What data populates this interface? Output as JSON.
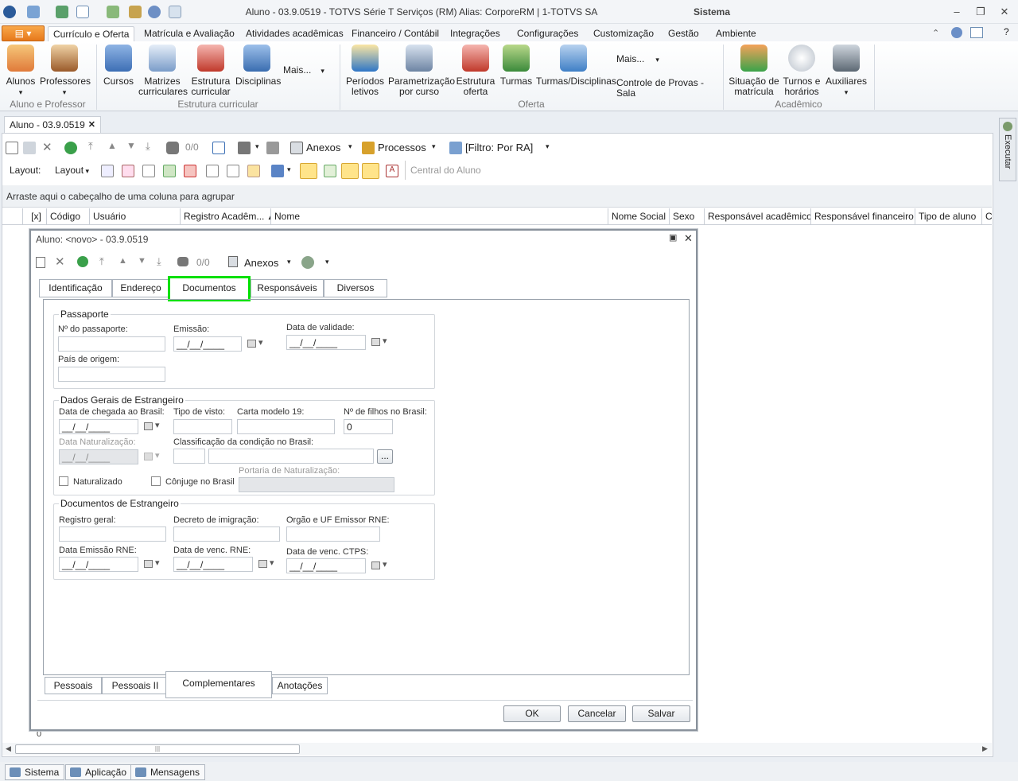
{
  "window": {
    "title": "Aluno - 03.9.0519 - TOTVS Série T Serviços (RM) Alias: CorporeRM | 1-TOTVS SA",
    "system_label": "Sistema"
  },
  "ribbon": {
    "tabs": [
      "Currículo e Oferta",
      "Matrícula e Avaliação",
      "Atividades acadêmicas",
      "Financeiro / Contábil",
      "Integrações",
      "Configurações",
      "Customização",
      "Gestão",
      "Ambiente"
    ],
    "active_tab": "Currículo e Oferta",
    "groups": [
      {
        "label": "Aluno e Professor",
        "buttons": [
          "Alunos",
          "Professores"
        ]
      },
      {
        "label": "Estrutura curricular",
        "buttons": [
          "Cursos",
          "Matrizes curriculares",
          "Estrutura curricular",
          "Disciplinas",
          "Mais..."
        ]
      },
      {
        "label": "Oferta",
        "buttons": [
          "Períodos letivos",
          "Parametrização por curso",
          "Estrutura oferta",
          "Turmas",
          "Turmas/Disciplinas",
          "Mais...",
          "Controle de Provas - Sala"
        ]
      },
      {
        "label": "Acadêmico",
        "buttons": [
          "Situação de matrícula",
          "Turnos e horários",
          "Auxiliares"
        ]
      }
    ]
  },
  "doc_tab": {
    "label": "Aluno - 03.9.0519"
  },
  "toolbar": {
    "counter": "0/0",
    "anexos": "Anexos",
    "processos": "Processos",
    "filtro": "[Filtro: Por RA]",
    "layout_label": "Layout:",
    "layout_btn": "Layout",
    "central": "Central do Aluno"
  },
  "grid": {
    "group_hint": "Arraste aqui o cabeçalho de uma coluna para agrupar",
    "columns": [
      "[x]",
      "Código",
      "Usuário",
      "Registro Acadêm...",
      "Nome",
      "Nome Social",
      "Sexo",
      "Responsável acadêmico",
      "Responsável financeiro",
      "Tipo de aluno",
      "C"
    ],
    "row_count": "0"
  },
  "side_panel": {
    "label": "Executar"
  },
  "statusbar": {
    "buttons": [
      "Sistema",
      "Aplicação",
      "Mensagens"
    ]
  },
  "modal": {
    "title": "Aluno: <novo> - 03.9.0519",
    "toolbar": {
      "counter": "0/0",
      "anexos": "Anexos"
    },
    "tabs": [
      "Identificação",
      "Endereço",
      "Documentos",
      "Responsáveis",
      "Diversos"
    ],
    "active_tab": "Documentos",
    "bottom_tabs": [
      "Pessoais",
      "Pessoais II",
      "Complementares",
      "Anotações"
    ],
    "active_bottom_tab": "Complementares",
    "passaporte": {
      "legend": "Passaporte",
      "numero_label": "Nº do passaporte:",
      "emissao_label": "Emissão:",
      "emissao_value": "__/__/____",
      "validade_label": "Data de validade:",
      "validade_value": "__/__/____",
      "pais_label": "País de origem:"
    },
    "estrangeiro": {
      "legend": "Dados Gerais de Estrangeiro",
      "chegada_label": "Data de chegada ao Brasil:",
      "chegada_value": "__/__/____",
      "visto_label": "Tipo de visto:",
      "carta_label": "Carta modelo 19:",
      "filhos_label": "Nº de filhos no Brasil:",
      "filhos_value": "0",
      "naturalizacao_label": "Data Naturalização:",
      "naturalizacao_value": "__/__/____",
      "classificacao_label": "Classificação da condição no Brasil:",
      "lookup_btn": "...",
      "naturalizado_label": "Naturalizado",
      "conjuge_label": "Cônjuge no Brasil",
      "portaria_label": "Portaria de Naturalização:"
    },
    "documentos": {
      "legend": "Documentos de Estrangeiro",
      "rg_label": "Registro geral:",
      "decreto_label": "Decreto de imigração:",
      "orgao_label": "Orgão e UF Emissor RNE:",
      "emissao_rne_label": "Data Emissão RNE:",
      "emissao_rne_value": "__/__/____",
      "venc_rne_label": "Data de venc. RNE:",
      "venc_rne_value": "__/__/____",
      "venc_ctps_label": "Data de venc. CTPS:",
      "venc_ctps_value": "__/__/____"
    },
    "buttons": {
      "ok": "OK",
      "cancel": "Cancelar",
      "save": "Salvar"
    }
  },
  "colors": {
    "highlight": "#00e000",
    "accent": "#e6781b"
  }
}
